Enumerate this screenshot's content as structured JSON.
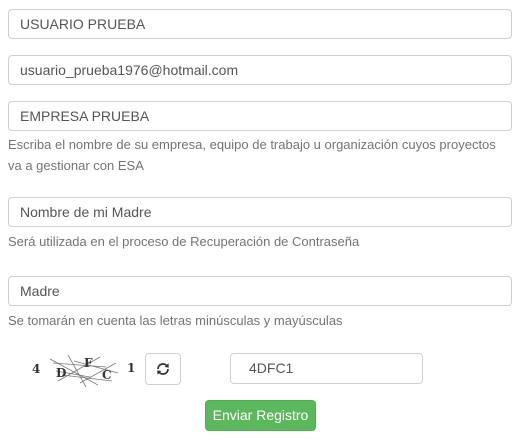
{
  "form": {
    "fields": [
      {
        "value": "USUARIO PRUEBA"
      },
      {
        "value": "usuario_prueba1976@hotmail.com"
      },
      {
        "value": "EMPRESA PRUEBA",
        "help": "Escriba el nombre de su empresa, equipo de trabajo u organización cuyos proyectos va a gestionar con ESA"
      },
      {
        "value": "Nombre de mi Madre",
        "help": "Será utilizada en el proceso de Recuperación de Contraseña"
      },
      {
        "value": "Madre",
        "help": "Se tomarán en cuenta las letras minúsculas y mayúsculas"
      }
    ],
    "captcha": {
      "chars": [
        "4",
        "D",
        "F",
        "C",
        "1"
      ],
      "refresh_icon": "refresh-icon",
      "input_value": "4DFC1"
    },
    "submit_label": "Enviar Registro"
  },
  "colors": {
    "submit_bg": "#5cb85c",
    "border": "#cfcfcf",
    "help_text": "#737373"
  }
}
